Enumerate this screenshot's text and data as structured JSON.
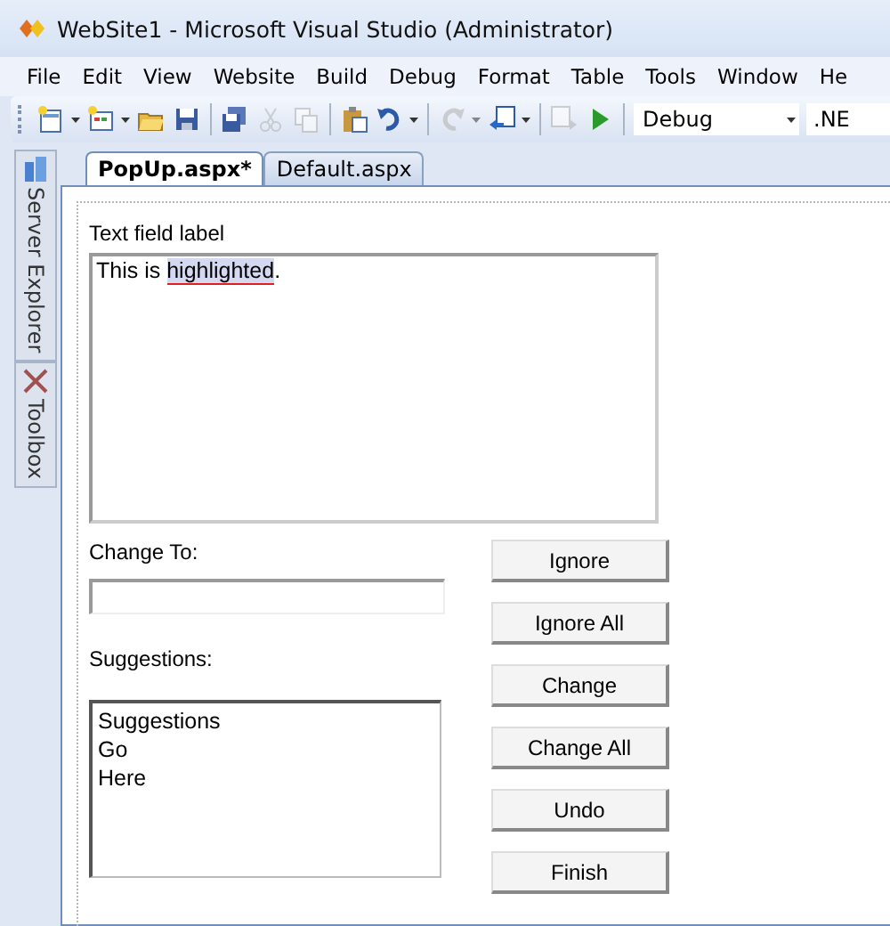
{
  "window": {
    "title": "WebSite1 - Microsoft Visual Studio (Administrator)"
  },
  "menu": [
    "File",
    "Edit",
    "View",
    "Website",
    "Build",
    "Debug",
    "Format",
    "Table",
    "Tools",
    "Window",
    "He"
  ],
  "toolbar": {
    "buttons": [
      {
        "kind": "new-project",
        "disabled": false,
        "dropdown": true
      },
      {
        "kind": "add-item",
        "disabled": false,
        "dropdown": true
      },
      {
        "kind": "open",
        "disabled": false,
        "dropdown": false
      },
      {
        "kind": "save",
        "disabled": false,
        "dropdown": false
      },
      {
        "kind": "save-all",
        "disabled": false,
        "dropdown": false
      },
      {
        "kind": "cut",
        "disabled": true,
        "dropdown": false
      },
      {
        "kind": "copy",
        "disabled": true,
        "dropdown": false
      },
      {
        "kind": "paste",
        "disabled": false,
        "dropdown": false
      },
      {
        "kind": "undo",
        "disabled": false,
        "dropdown": true
      },
      {
        "kind": "redo",
        "disabled": true,
        "dropdown": true
      },
      {
        "kind": "navigate-back",
        "disabled": false,
        "dropdown": true
      },
      {
        "kind": "navigate-forward",
        "disabled": true,
        "dropdown": false
      },
      {
        "kind": "start",
        "disabled": false,
        "dropdown": false
      }
    ],
    "configuration": "Debug",
    "platform": ".NE"
  },
  "side_tabs": [
    {
      "label": "Server Explorer",
      "kind": "server"
    },
    {
      "label": "Toolbox",
      "kind": "toolbox"
    }
  ],
  "tabs": [
    {
      "label": "PopUp.aspx*",
      "selected": true
    },
    {
      "label": "Default.aspx",
      "selected": false
    }
  ],
  "form": {
    "text_label": "Text field label",
    "text": {
      "before": "This is ",
      "highlighted": "highlighted",
      "after": "."
    },
    "change_to_label": "Change To:",
    "suggestions_label": "Suggestions:",
    "suggestions": [
      "Suggestions",
      "Go",
      "Here"
    ],
    "buttons": [
      "Ignore",
      "Ignore All",
      "Change",
      "Change All",
      "Undo",
      "Finish"
    ]
  }
}
